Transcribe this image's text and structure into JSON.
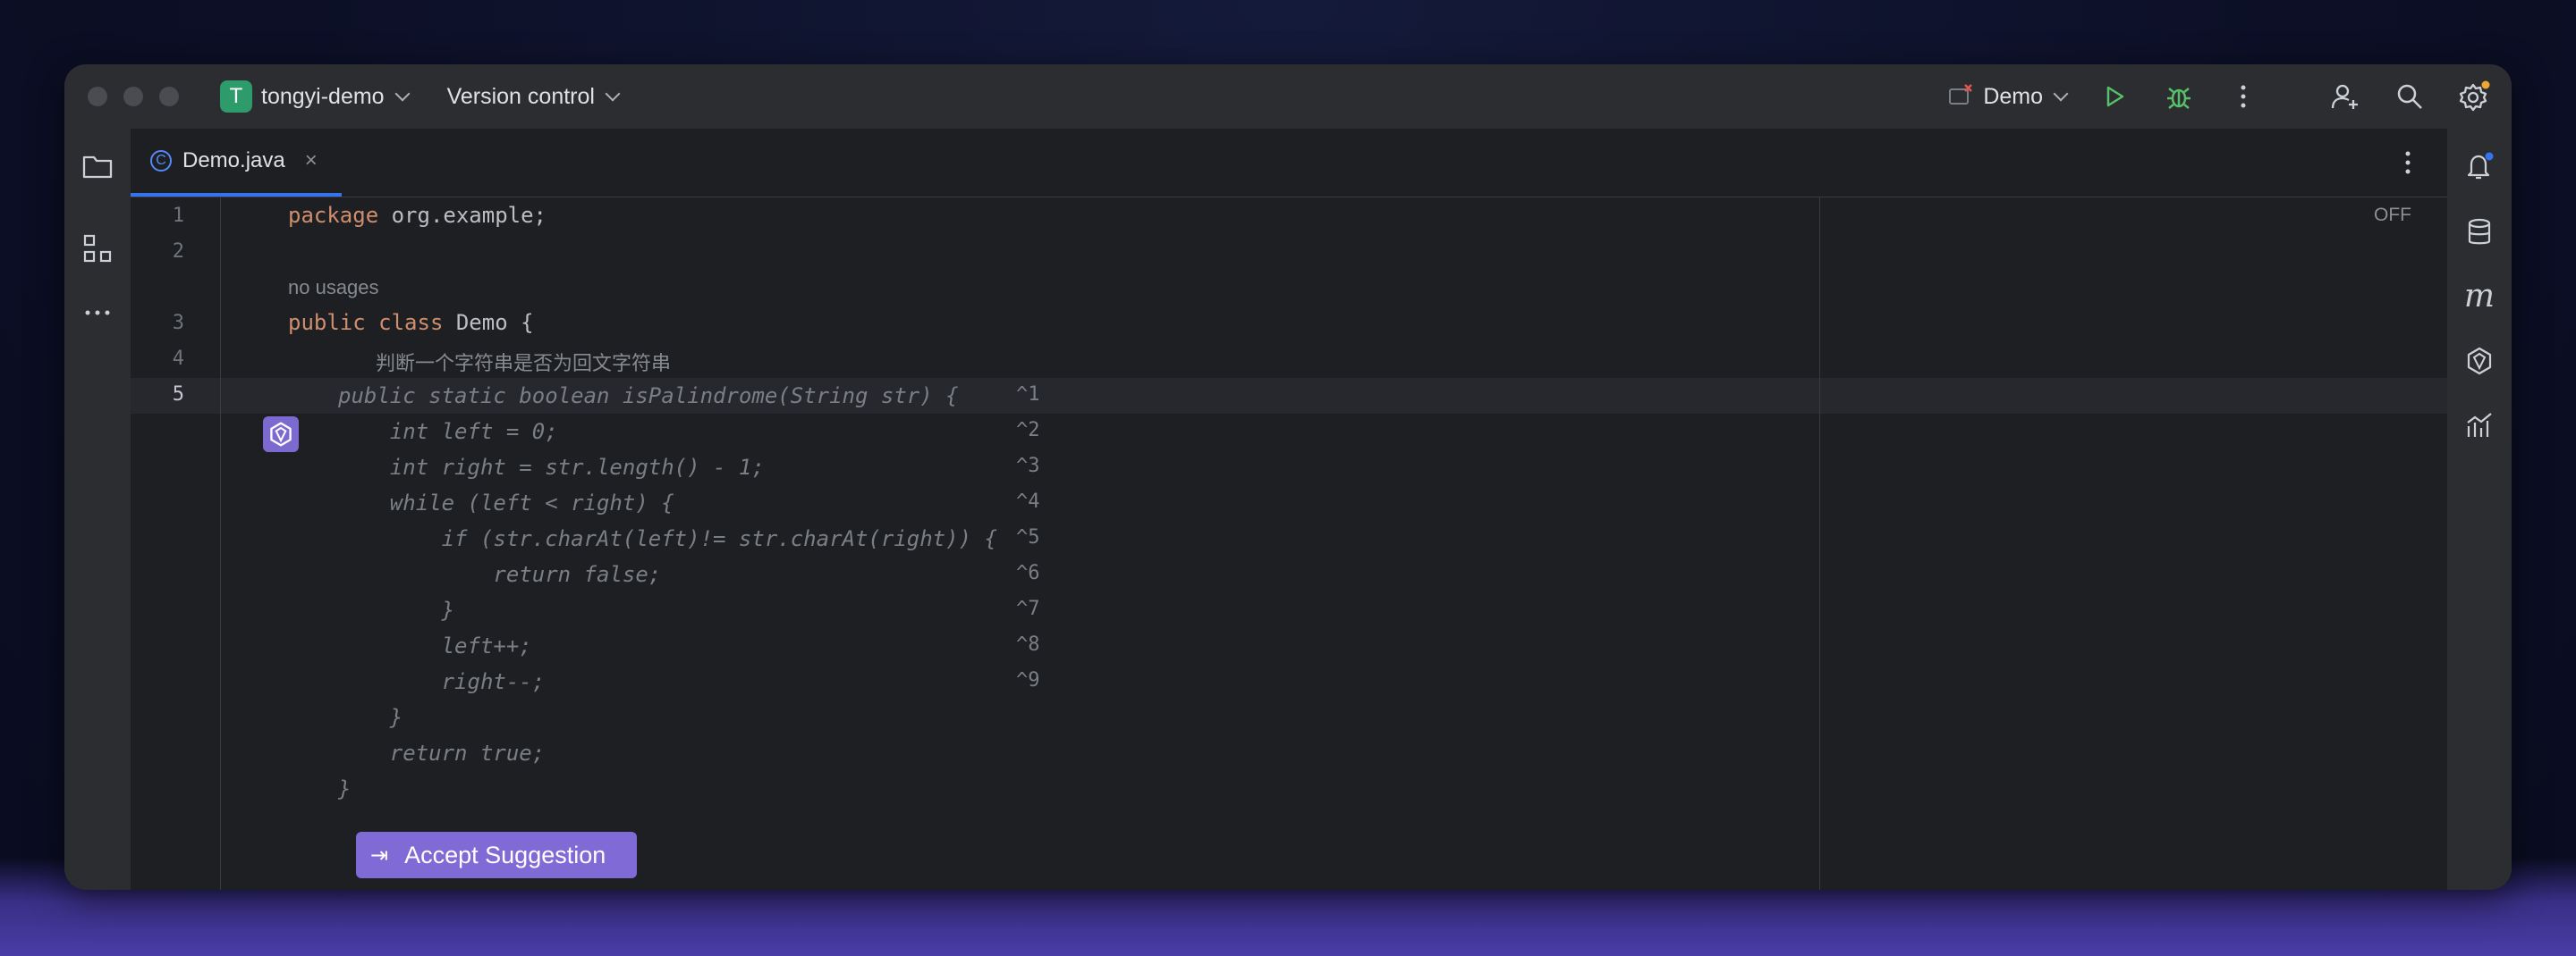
{
  "titlebar": {
    "project_badge": "T",
    "project_name": "tongyi-demo",
    "version_control": "Version control",
    "run_config": "Demo"
  },
  "tab": {
    "label": "Demo.java",
    "icon_letter": "C",
    "close": "×"
  },
  "editor": {
    "status": "OFF",
    "usage_hint": "no usages",
    "comment_hint": "判断一个字符串是否为回文字符串",
    "lines": [
      {
        "n": "1",
        "code_kw": "package",
        "code_rest": " org.example;"
      },
      {
        "n": "2"
      },
      {
        "n": "3",
        "code_kw": "public class",
        "code_rest": " Demo {"
      },
      {
        "n": "4"
      },
      {
        "n": "5"
      }
    ],
    "suggestion": [
      {
        "text": "public static boolean isPalindrome(String str) {",
        "shortcut": "^1"
      },
      {
        "text": "    int left = 0;",
        "shortcut": "^2"
      },
      {
        "text": "    int right = str.length() - 1;",
        "shortcut": "^3"
      },
      {
        "text": "    while (left < right) {",
        "shortcut": "^4"
      },
      {
        "text": "        if (str.charAt(left)!= str.charAt(right)) {",
        "shortcut": "^5"
      },
      {
        "text": "            return false;",
        "shortcut": "^6"
      },
      {
        "text": "        }",
        "shortcut": "^7"
      },
      {
        "text": "        left++;",
        "shortcut": "^8"
      },
      {
        "text": "        right--;",
        "shortcut": "^9"
      },
      {
        "text": "    }",
        "shortcut": ""
      },
      {
        "text": "    return true;",
        "shortcut": ""
      },
      {
        "text": "}",
        "shortcut": ""
      }
    ],
    "accept_label": "Accept Suggestion",
    "accept_key": "⇥"
  },
  "colors": {
    "accent": "#3574f0",
    "ai_purple": "#7f6ad6",
    "keyword": "#cf8e6d",
    "badge_green": "#2d9b6a"
  },
  "icons": [
    "folder-icon",
    "structure-icon",
    "more-icon",
    "run-icon",
    "debug-icon",
    "add-user-icon",
    "search-icon",
    "settings-icon",
    "notifications-icon",
    "database-icon",
    "maven-icon",
    "tongyi-icon",
    "profiler-icon"
  ]
}
